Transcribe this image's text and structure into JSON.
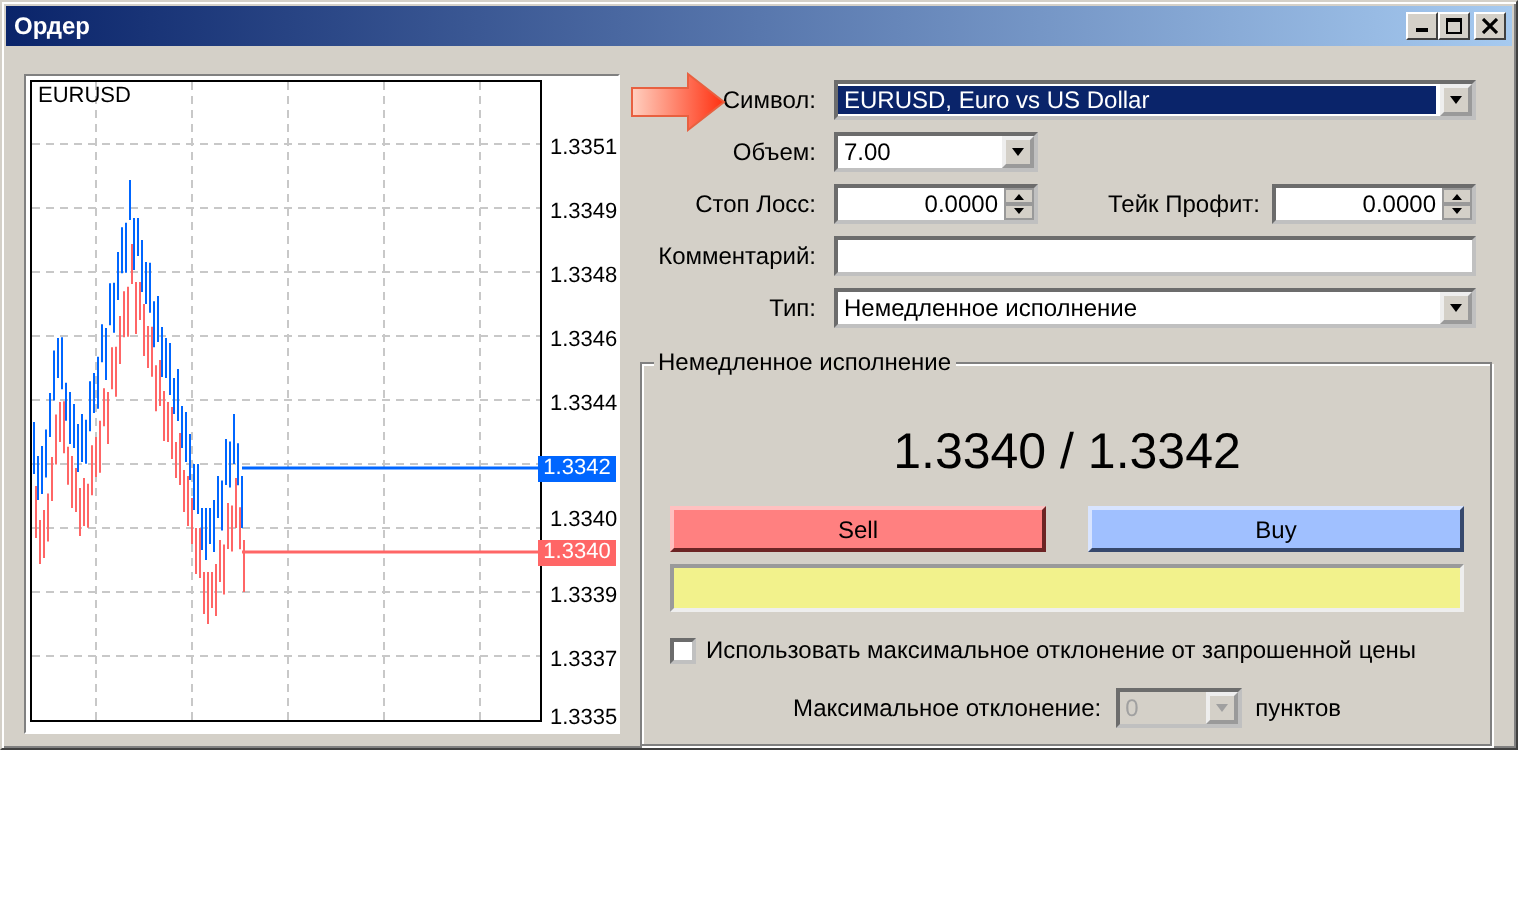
{
  "window": {
    "title": "Ордер"
  },
  "chart": {
    "symbol": "EURUSD",
    "price_labels": [
      "1.3351",
      "1.3349",
      "1.3348",
      "1.3346",
      "1.3344",
      "1.3340",
      "1.3339",
      "1.3337",
      "1.3335"
    ],
    "ask": {
      "price": "1.3342",
      "color": "#0066ff"
    },
    "bid": {
      "price": "1.3340",
      "color": "#ff6666"
    }
  },
  "form": {
    "symbol": {
      "label": "Символ:",
      "value": "EURUSD, Euro vs US Dollar",
      "highlighted": true
    },
    "volume": {
      "label": "Объем:",
      "value": "7.00"
    },
    "stop_loss": {
      "label": "Стоп Лосс:",
      "value": "0.0000"
    },
    "take_profit": {
      "label": "Тейк Профит:",
      "value": "0.0000"
    },
    "comment": {
      "label": "Комментарий:"
    },
    "type": {
      "label": "Тип:",
      "value": "Немедленное исполнение"
    }
  },
  "execution": {
    "title": "Немедленное исполнение",
    "quote": "1.3340 / 1.3342",
    "buttons": [
      {
        "label": "Sell",
        "kind": "sell"
      },
      {
        "label": "Buy",
        "kind": "buy"
      }
    ],
    "max_deviation_check": {
      "label": "Использовать максимальное отклонение от запрошенной цены",
      "checked": false
    },
    "max_deviation": {
      "label": "Максимальное отклонение:",
      "value": "0",
      "disabled": true,
      "unit": "пунктов"
    }
  }
}
